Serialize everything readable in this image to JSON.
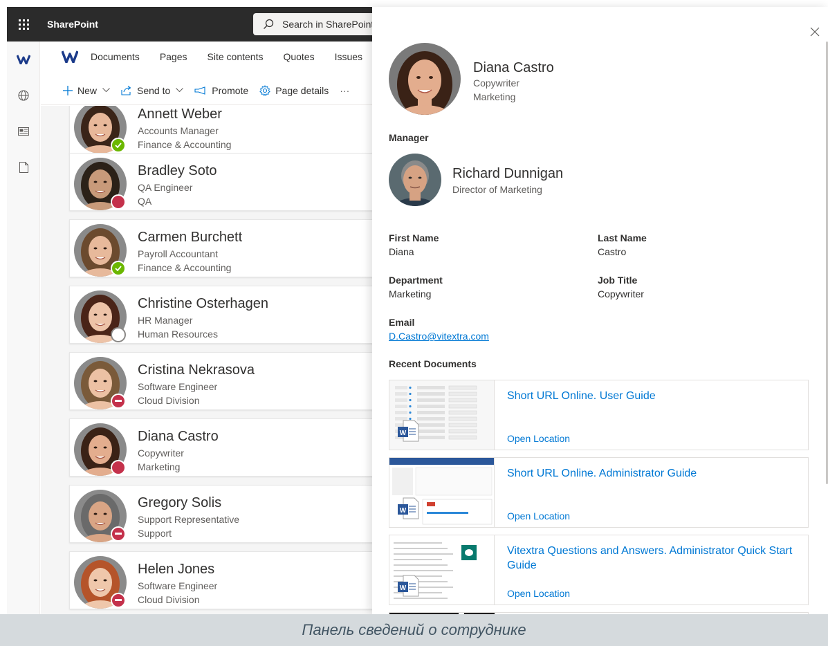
{
  "suitebar": {
    "brand": "SharePoint",
    "search_placeholder": "Search in SharePoint"
  },
  "site_nav": {
    "links": [
      "Documents",
      "Pages",
      "Site contents",
      "Quotes",
      "Issues"
    ]
  },
  "command_bar": {
    "new_label": "New",
    "send_to_label": "Send to",
    "promote_label": "Promote",
    "page_details_label": "Page details",
    "more_label": "···"
  },
  "people": [
    {
      "name": "Annett Weber",
      "title": "Accounts Manager",
      "department": "Finance & Accounting",
      "status": "available",
      "hair": "#3a2418",
      "skin": "#e8b89a"
    },
    {
      "name": "Bradley Soto",
      "title": "QA Engineer",
      "department": "QA",
      "status": "busy",
      "hair": "#2b2118",
      "skin": "#c89a7a"
    },
    {
      "name": "Carmen Burchett",
      "title": "Payroll Accountant",
      "department": "Finance & Accounting",
      "status": "available",
      "hair": "#6b4a2e",
      "skin": "#e7b99b"
    },
    {
      "name": "Christine Osterhagen",
      "title": "HR Manager",
      "department": "Human Resources",
      "status": "offline",
      "hair": "#4a2418",
      "skin": "#edc3a8"
    },
    {
      "name": "Cristina Nekrasova",
      "title": "Software Engineer",
      "department": "Cloud Division",
      "status": "dnd",
      "hair": "#7a5a3a",
      "skin": "#ecc1a4"
    },
    {
      "name": "Diana Castro",
      "title": "Copywriter",
      "department": "Marketing",
      "status": "busy",
      "hair": "#3a2216",
      "skin": "#e3ad8e"
    },
    {
      "name": "Gregory Solis",
      "title": "Support Representative",
      "department": "Support",
      "status": "dnd",
      "hair": "#6a6a6a",
      "skin": "#d9a585"
    },
    {
      "name": "Helen Jones",
      "title": "Software Engineer",
      "department": "Cloud Division",
      "status": "dnd",
      "hair": "#b5542a",
      "skin": "#efc7ab"
    }
  ],
  "panel": {
    "name": "Diana Castro",
    "title": "Copywriter",
    "department": "Marketing",
    "manager_label": "Manager",
    "manager_name": "Richard Dunnigan",
    "manager_title": "Director of Marketing",
    "first_name_label": "First Name",
    "first_name": "Diana",
    "last_name_label": "Last Name",
    "last_name": "Castro",
    "department_label": "Department",
    "department_value": "Marketing",
    "job_title_label": "Job Title",
    "job_title_value": "Copywriter",
    "email_label": "Email",
    "email": "D.Castro@vitextra.com",
    "recent_docs_label": "Recent Documents",
    "docs": [
      {
        "title": "Short URL Online. User Guide",
        "open": "Open Location"
      },
      {
        "title": "Short URL Online. Administrator Guide",
        "open": "Open Location"
      },
      {
        "title": "Vitextra Questions and Answers. Administrator Quick Start Guide",
        "open": "Open Location"
      }
    ]
  },
  "caption": "Панель сведений о сотруднике",
  "colors": {
    "suitebar": "#2b2b2b",
    "accent": "#0078d4",
    "available": "#6bb700",
    "busy": "#c4314b"
  }
}
